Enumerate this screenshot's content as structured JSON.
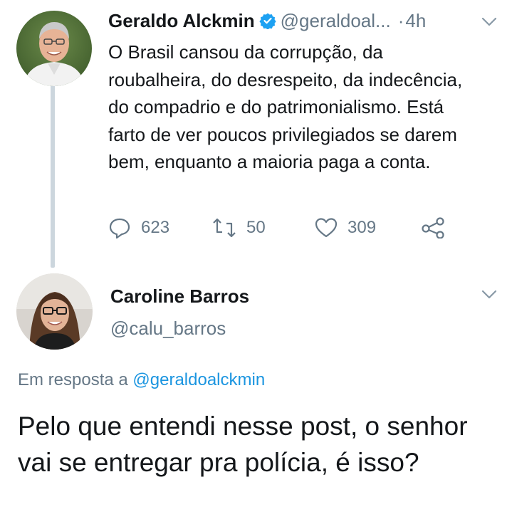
{
  "tweet1": {
    "author_name": "Geraldo Alckmin",
    "author_handle": "@geraldoal...",
    "separator": "·",
    "time": "4h",
    "text": "O Brasil cansou da corrupção, da roubalheira, do desrespeito, da indecência, do compadrio e do patrimonialismo. Está farto de ver poucos privilegiados se darem bem, enquanto a maioria paga a conta.",
    "actions": {
      "replies": "623",
      "retweets": "50",
      "likes": "309"
    },
    "icons": [
      "verified-badge-icon",
      "chevron-down-icon",
      "reply-icon",
      "retweet-icon",
      "heart-icon",
      "share-icon"
    ]
  },
  "tweet2": {
    "author_name": "Caroline Barros",
    "author_handle": "@calu_barros",
    "reply_prefix": "Em resposta a",
    "reply_mention": "@geraldoalckmin",
    "text": "Pelo que entendi nesse post, o senhor vai se entregar pra polícia, é isso?"
  },
  "colors": {
    "primary_text": "#14171a",
    "secondary_text": "#657786",
    "link": "#1b95e0",
    "verified": "#1da1f2",
    "thread_line": "#ccd6dd"
  }
}
